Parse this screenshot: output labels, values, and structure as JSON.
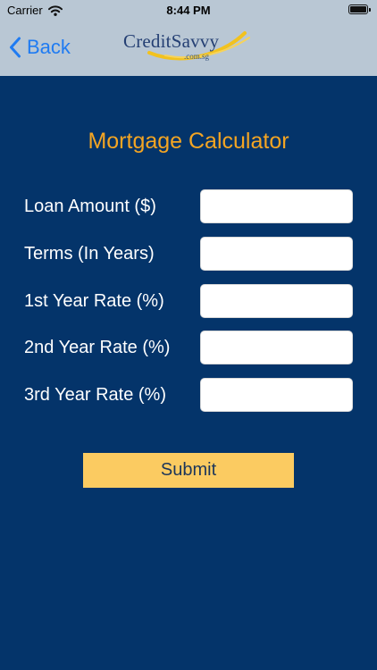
{
  "status_bar": {
    "carrier": "Carrier",
    "time": "8:44 PM",
    "icons": [
      "wifi-icon",
      "battery-icon"
    ]
  },
  "nav": {
    "back_label": "Back",
    "logo_text": "CreditSavvy",
    "logo_subtext": ".com.sg"
  },
  "page": {
    "title": "Mortgage Calculator"
  },
  "form": {
    "fields": [
      {
        "label": "Loan Amount ($)",
        "value": ""
      },
      {
        "label": "Terms (In Years)",
        "value": ""
      },
      {
        "label": "1st Year Rate (%)",
        "value": ""
      },
      {
        "label": "2nd Year Rate (%)",
        "value": ""
      },
      {
        "label": "3rd Year Rate (%)",
        "value": ""
      }
    ],
    "submit_label": "Submit"
  },
  "colors": {
    "background": "#04346a",
    "nav_background": "#b9c7d4",
    "title": "#f4a523",
    "submit_button": "#fbcb61",
    "back_link": "#1f7bf2"
  }
}
